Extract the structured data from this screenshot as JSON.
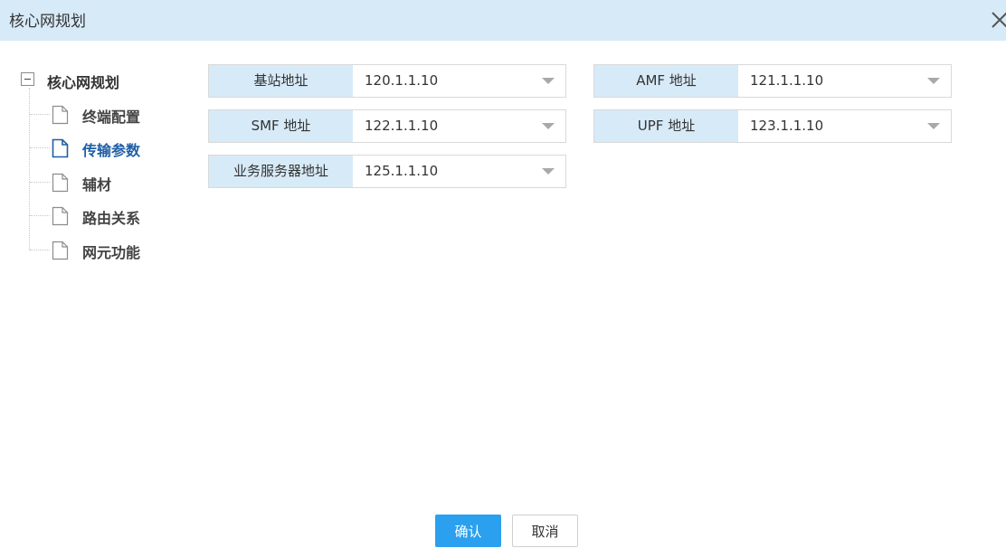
{
  "dialog": {
    "title": "核心网规划",
    "close_icon": "close-icon"
  },
  "tree": {
    "root": {
      "label": "核心网规划",
      "expanded": true
    },
    "items": [
      {
        "label": "终端配置",
        "icon": "document-icon",
        "active": false
      },
      {
        "label": "传输参数",
        "icon": "document-icon",
        "active": true
      },
      {
        "label": "辅材",
        "icon": "document-icon",
        "active": false
      },
      {
        "label": "路由关系",
        "icon": "document-icon",
        "active": false
      },
      {
        "label": "网元功能",
        "icon": "document-icon",
        "active": false
      }
    ]
  },
  "form": {
    "fields": [
      {
        "label": "基站地址",
        "value": "120.1.1.10"
      },
      {
        "label": "AMF 地址",
        "value": "121.1.1.10"
      },
      {
        "label": "SMF 地址",
        "value": "122.1.1.10"
      },
      {
        "label": "UPF 地址",
        "value": "123.1.1.10"
      },
      {
        "label": "业务服务器地址",
        "value": "125.1.1.10"
      }
    ]
  },
  "buttons": {
    "confirm": "确认",
    "cancel": "取消"
  },
  "colors": {
    "title_bar": "#d7eaf8",
    "label_bg": "#d7eaf8",
    "active_node": "#1f5fa6",
    "primary_button": "#2aa0ef"
  }
}
